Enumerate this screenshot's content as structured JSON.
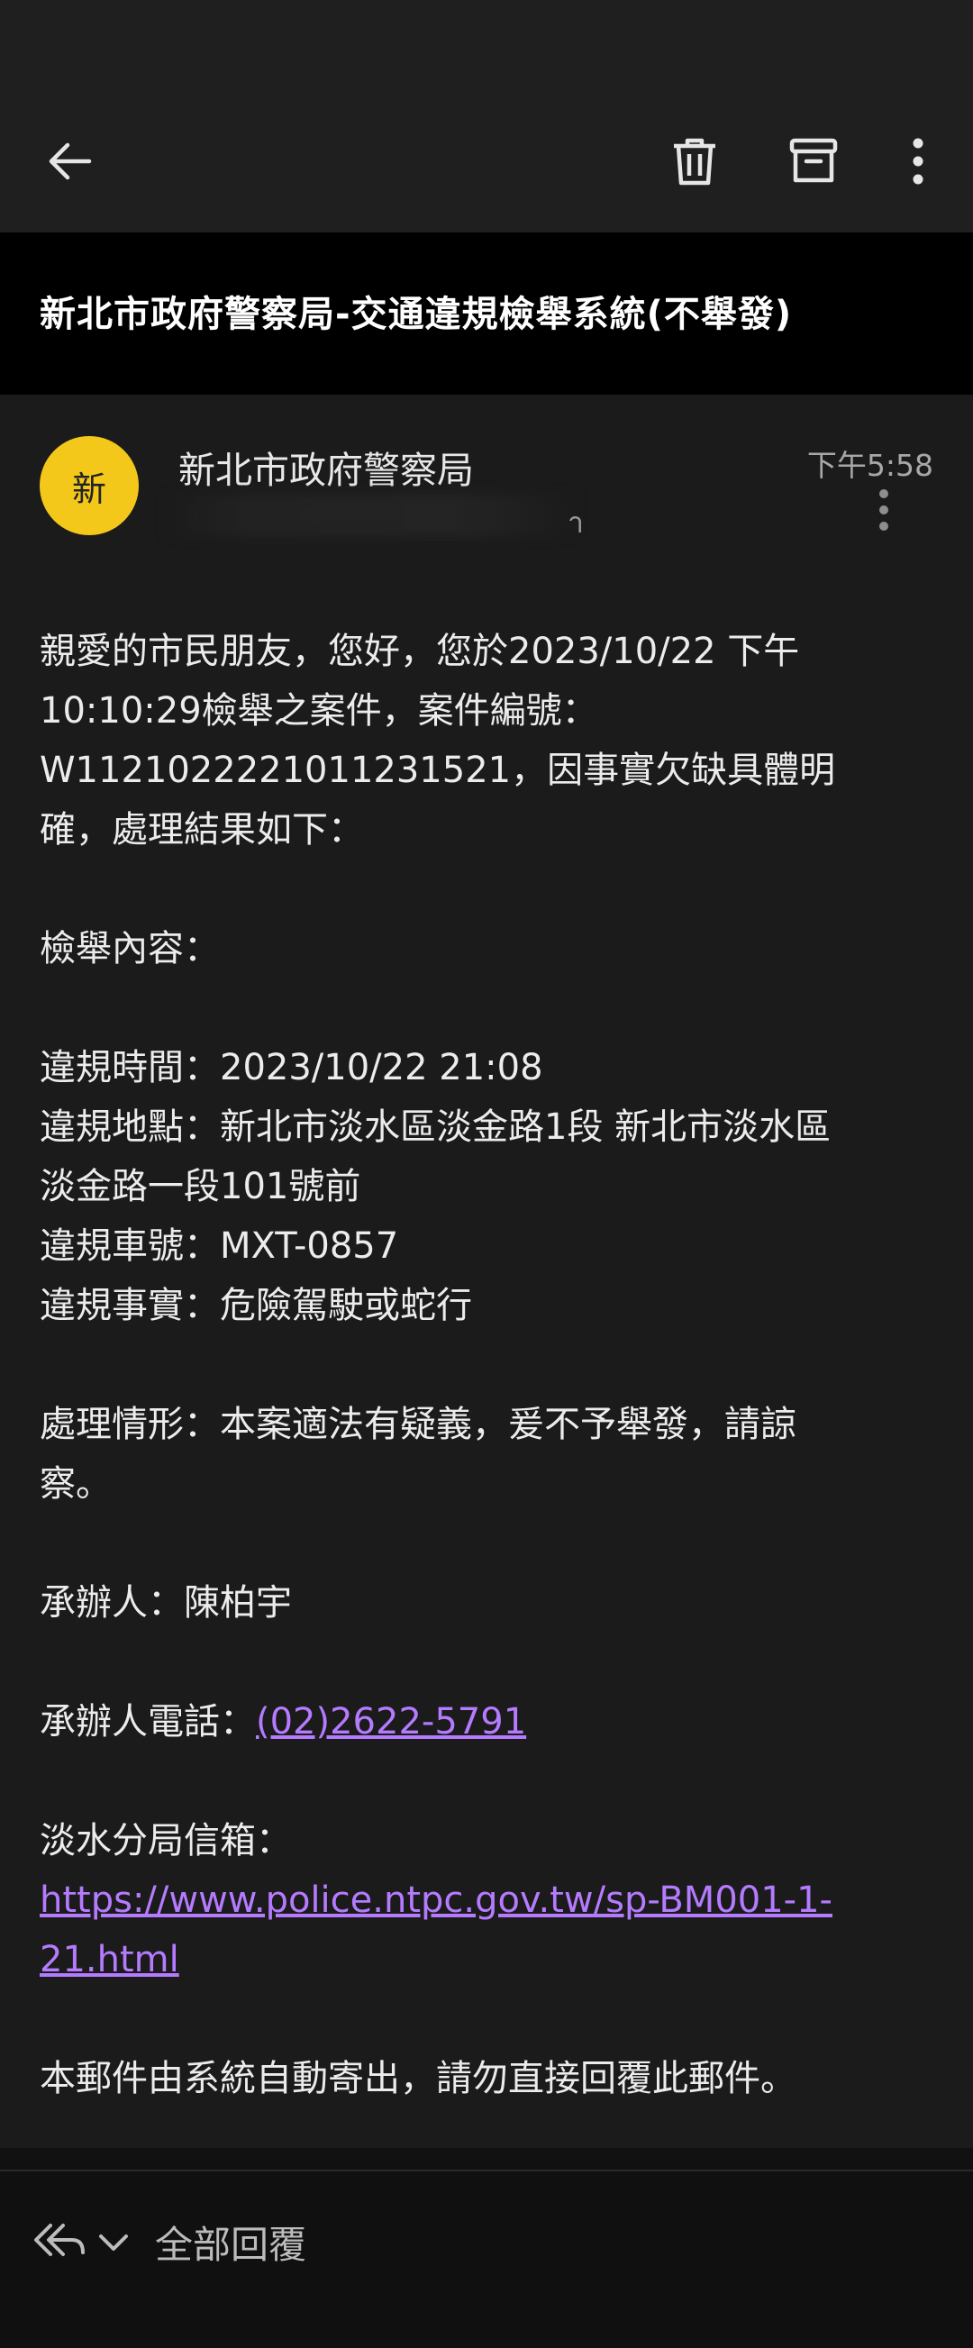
{
  "header": {
    "back_icon": "arrow-left-icon",
    "delete_icon": "trash-icon",
    "archive_icon": "archive-icon",
    "more_icon": "more-vertical-icon"
  },
  "email": {
    "subject": "新北市政府警察局-交通違規檢舉系統(不舉發)",
    "sender": {
      "avatar_letter": "新",
      "avatar_color": "#f4c81a",
      "name": "新北市政府警察局",
      "email_partial": "า"
    },
    "time": "下午5:58",
    "body_lines": {
      "l1": "親愛的市民朋友，您好，您於2023/10/22 下午",
      "l2": "10:10:29檢舉之案件，案件編號：",
      "l3": "W1121022221011231521，因事實欠缺具體明",
      "l4": "確，處理結果如下：",
      "l5": "檢舉內容：",
      "l6": "違規時間：2023/10/22 21:08",
      "l7": "違規地點：新北市淡水區淡金路1段 新北市淡水區",
      "l8": "淡金路一段101號前",
      "l9": "違規車號：MXT-0857",
      "l10": "違規事實：危險駕駛或蛇行",
      "l11": "處理情形：本案適法有疑義，爰不予舉發，請諒",
      "l12": "察。",
      "l13": "承辦人：陳柏宇",
      "l14_label": "承辦人電話：",
      "l14_phone": "(02)2622-5791",
      "l15": "淡水分局信箱：",
      "l16_link_part1": "https://www.police.ntpc.gov.tw/sp-BM001-1-",
      "l16_link_part2": "21.html",
      "l17": "本郵件由系統自動寄出，請勿直接回覆此郵件。"
    },
    "link_color": "#b57bff"
  },
  "bottom": {
    "reply_all_icon": "reply-all-icon",
    "dropdown_icon": "chevron-down-icon",
    "reply_all_label": "全部回覆"
  }
}
